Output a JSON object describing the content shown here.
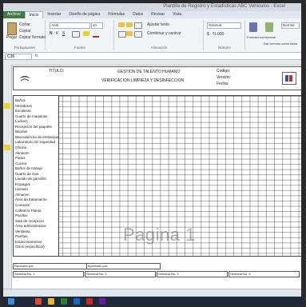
{
  "window": {
    "title": "Plantilla de Registro y Estadisticas ABC Vehiculos - Excel"
  },
  "tabs": [
    "Archivo",
    "Inicio",
    "Insertar",
    "Diseño de página",
    "Fórmulas",
    "Datos",
    "Revisar",
    "Vista"
  ],
  "ribbon": {
    "clipboard": {
      "paste": "Pegar",
      "cut": "Cortar",
      "copy": "Copiar",
      "format_painter": "Copiar formato",
      "label": "Portapapeles"
    },
    "font": {
      "name": "Arial",
      "size": "10",
      "label": "Fuente"
    },
    "alignment": {
      "wrap": "Ajustar texto",
      "merge": "Combinar y centrar",
      "label": "Alineación"
    },
    "number": {
      "format": "General",
      "label": "Número"
    },
    "styles": {
      "conditional": "Formato condicional",
      "as_table": "Dar formato como tabla",
      "normal": "Normal"
    }
  },
  "formula_bar": {
    "name_box": "C36",
    "fx": "fx"
  },
  "sheet": {
    "form_title_1": "GESTION DE TALENTO HUMANO",
    "form_title_2": "VERIFICACION LIMPIEZA Y DESINFECCION",
    "titulo_label": "TITULO:",
    "code_label": "Codigo:",
    "version_label": "Versión:",
    "date_label": "Fecha:",
    "rows": [
      "Baños",
      "Vestidores",
      "Escaleras",
      "Cuarto de maquinas",
      "Lockers",
      "Recepción del paquete",
      "Bandas",
      "Bascula/Área de embarque",
      "Laboratorio de seguridad",
      "Oficina",
      "Almacén",
      "Patios",
      "Cocina",
      "Baños de trabajo",
      "Cuarto de Gas",
      "Lavado de garrafón",
      "Enjuague",
      "Llenado",
      "Almacen",
      "Área de tratamiento",
      "Comedor",
      "Cafetería Planta",
      "Pasillos",
      "Sala de recepción",
      "Área administrativa",
      "Ventanas",
      "Puertas",
      "Estacionamiento",
      "Otros (especificar)"
    ],
    "watermark": "Pagina 1",
    "footer": {
      "revisado": "Revisado por: ",
      "aprobado": "Aprobado por: ",
      "semana1": "Semana No. 1 ",
      "semana2": "Semana No. 2 ",
      "semana3": "Semana No. 3 ",
      "semana4": "Semana No. 4 "
    }
  },
  "colors": {
    "file_tab": "#3b7d3b",
    "yellow_marker": "#f1d21b"
  }
}
